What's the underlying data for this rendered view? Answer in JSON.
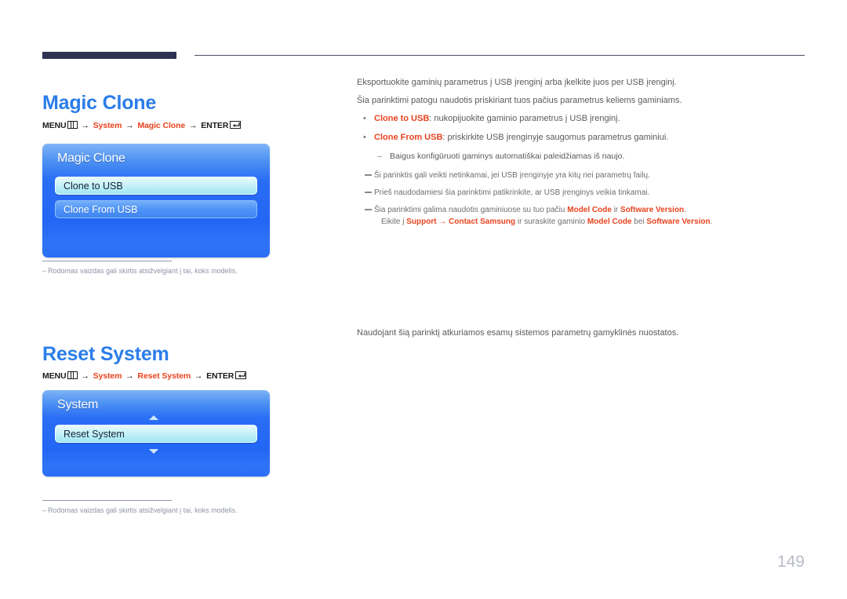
{
  "page": {
    "number": "149"
  },
  "sections": [
    {
      "id": "magic-clone",
      "title": "Magic Clone",
      "path": {
        "menu_label": "MENU",
        "menu_icon": "menu-grid-icon",
        "arrow": "→",
        "step1": "System",
        "step2": "Magic Clone",
        "enter_label": "ENTER",
        "enter_icon": "enter-return-icon"
      },
      "osd": {
        "title": "Magic Clone",
        "rows": [
          {
            "label": "Clone to USB",
            "selected": true
          },
          {
            "label": "Clone From USB",
            "selected": false
          }
        ]
      },
      "footnote": {
        "dash": "–",
        "text": "Rodomas vaizdas gali skirtis atsižvelgiant į tai, koks modelis."
      },
      "body": {
        "paragraphs": [
          "Eksportuokite gaminių parametrus į USB įrenginį arba įkelkite juos per USB įrenginį.",
          "Šia parinktimi patogu naudotis priskiriant tuos pačius parametrus keliems gaminiams."
        ],
        "bullets": [
          {
            "bullet": "•",
            "term": "Clone to USB",
            "rest": ": nukopijuokite gaminio parametrus į USB įrenginį."
          },
          {
            "bullet": "•",
            "term": "Clone From USB",
            "rest": ": priskirkite USB įrenginyje saugomus parametrus gaminiui."
          }
        ],
        "sub_items": [
          {
            "dash": "–",
            "text": "Baigus konfigūruoti gaminys automatiškai paleidžiamas iš naujo."
          }
        ],
        "notes": [
          {
            "text": "Ši parinktis gali veikti netinkamai, jei USB įrenginyje yra kitų nei parametrų failų."
          },
          {
            "text": "Prieš naudodamiesi šia parinktimi patikrinkite, ar USB įrenginys veikia tinkamai."
          }
        ],
        "note_rich": {
          "line1_a": "Šia parinktimi galima naudotis gaminiuose su tuo pačiu ",
          "line1_b": "Model Code",
          "line1_c": " ir ",
          "line1_d": "Software Version",
          "line1_e": ".",
          "line2_a": "Eikite į ",
          "line2_b": "Support",
          "line2_c": " → ",
          "line2_d": "Contact Samsung",
          "line2_e": " ir suraskite gaminio ",
          "line2_f": "Model Code",
          "line2_g": " bei ",
          "line2_h": "Software Version",
          "line2_i": "."
        }
      }
    },
    {
      "id": "reset-system",
      "title": "Reset System",
      "path": {
        "menu_label": "MENU",
        "menu_icon": "menu-grid-icon",
        "arrow": "→",
        "step1": "System",
        "step2": "Reset System",
        "enter_label": "ENTER",
        "enter_icon": "enter-return-icon"
      },
      "osd": {
        "title": "System",
        "scroll_up": "scroll-up-arrow",
        "scroll_down": "scroll-down-arrow",
        "rows": [
          {
            "label": "Reset System",
            "selected": true
          }
        ]
      },
      "footnote": {
        "dash": "–",
        "text": "Rodomas vaizdas gali skirtis atsižvelgiant į tai, koks modelis."
      },
      "body": {
        "paragraphs": [
          "Naudojant šią parinktį atkuriamos esamų sistemos parametrų gamyklinės nuostatos."
        ]
      }
    }
  ],
  "colors": {
    "heading_blue": "#2b7de9",
    "accent_red": "#e8431f",
    "osd_blue": "#2266f5",
    "rule_navy": "#2e3252",
    "body_gray": "#5a5a5a",
    "footnote_gray": "#8e93a8",
    "page_number_gray": "#b8bcc6"
  }
}
